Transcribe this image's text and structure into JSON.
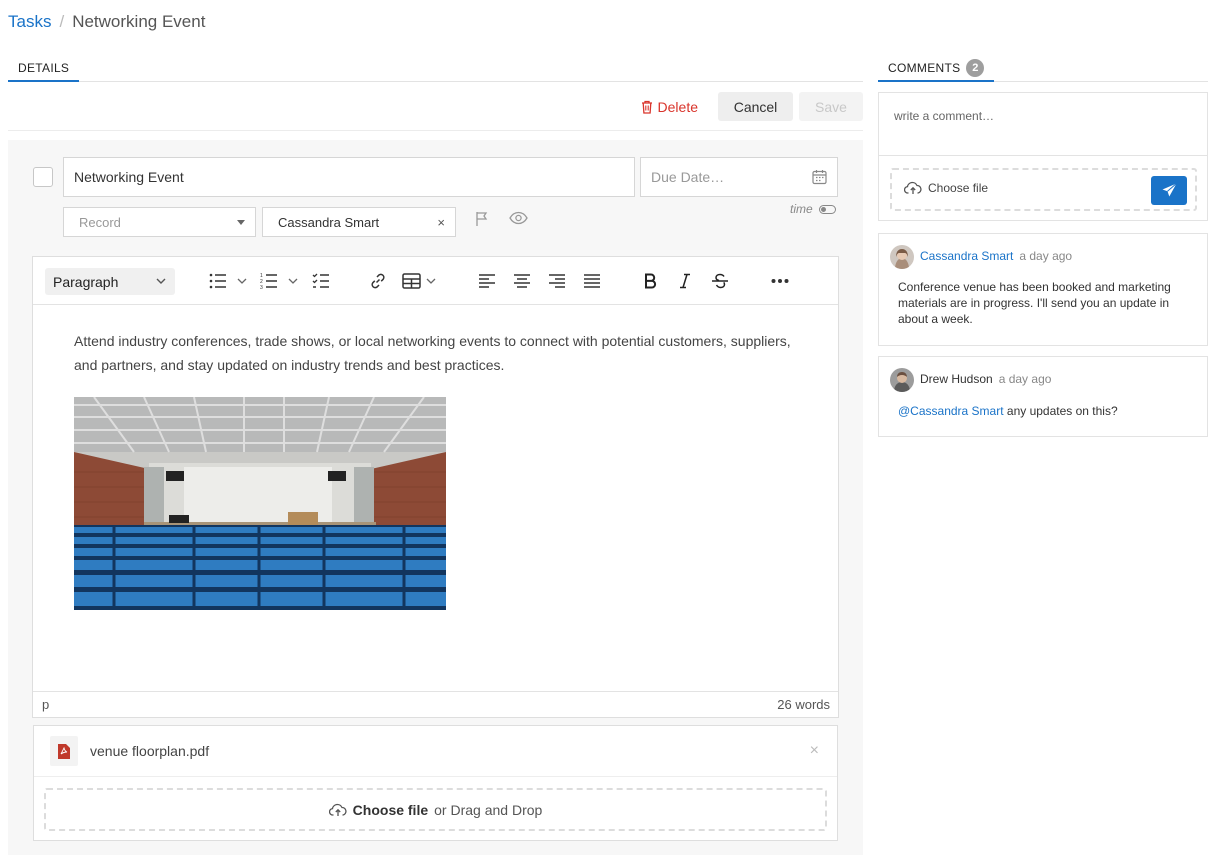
{
  "breadcrumb": {
    "root": "Tasks",
    "separator": "/",
    "current": "Networking Event"
  },
  "tabs": {
    "details": "DETAILS",
    "comments": "COMMENTS",
    "comments_count": "2"
  },
  "actions": {
    "delete": "Delete",
    "cancel": "Cancel",
    "save": "Save"
  },
  "task": {
    "title": "Networking Event",
    "due_placeholder": "Due Date…",
    "time_label": "time",
    "record_placeholder": "Record",
    "assignee": "Cassandra Smart",
    "clear": "×"
  },
  "editor": {
    "format": "Paragraph",
    "body": "Attend industry conferences, trade shows, or local networking events to connect with potential customers, suppliers, and partners, and stay updated on industry trends and best practices.",
    "status_tag": "p",
    "word_count": "26 words"
  },
  "attachments": {
    "file_name": "venue floorplan.pdf",
    "remove": "×",
    "choose": "Choose file",
    "drag": "or Drag and Drop"
  },
  "comments": {
    "placeholder": "write a comment…",
    "choose_file": "Choose file",
    "items": [
      {
        "author": "Cassandra Smart",
        "time": "a day ago",
        "text": "Conference venue has been booked and marketing materials are in progress. I'll send you an update in about a week."
      },
      {
        "author": "Drew Hudson",
        "time": "a day ago",
        "mention": "@Cassandra Smart",
        "text": " any updates on this?"
      }
    ]
  },
  "colors": {
    "accent": "#1a73c8",
    "danger": "#d9342b",
    "pdf": "#c0392b"
  }
}
